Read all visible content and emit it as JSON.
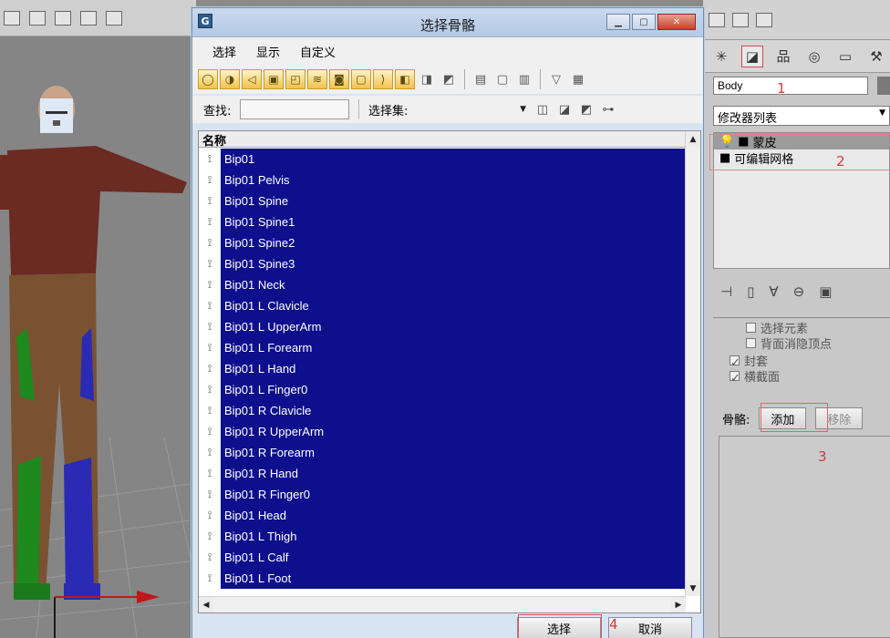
{
  "dialog": {
    "title": "选择骨骼",
    "menu": [
      "选择",
      "显示",
      "自定义"
    ],
    "find_label": "查找:",
    "find_value": "",
    "selection_set_label": "选择集:",
    "list_header": "名称",
    "bones": [
      "Bip01",
      "Bip01 Pelvis",
      "Bip01 Spine",
      "Bip01 Spine1",
      "Bip01 Spine2",
      "Bip01 Spine3",
      "Bip01 Neck",
      "Bip01 L Clavicle",
      "Bip01 L UpperArm",
      "Bip01 L Forearm",
      "Bip01 L Hand",
      "Bip01 L Finger0",
      "Bip01 R Clavicle",
      "Bip01 R UpperArm",
      "Bip01 R Forearm",
      "Bip01 R Hand",
      "Bip01 R Finger0",
      "Bip01 Head",
      "Bip01 L Thigh",
      "Bip01 L Calf",
      "Bip01 L Foot"
    ],
    "select_label": "选择",
    "cancel_label": "取消",
    "annotation": "4"
  },
  "command_panel": {
    "object_name": "Body",
    "modifier_list_label": "修改器列表",
    "stack": [
      {
        "label": "蒙皮",
        "selected": true
      },
      {
        "label": "可编辑网格",
        "selected": false
      }
    ],
    "options": [
      {
        "label": "选择元素",
        "checked": false
      },
      {
        "label": "背面消隐顶点",
        "checked": false
      },
      {
        "label": "封套",
        "checked": true
      },
      {
        "label": "横截面",
        "checked": true
      }
    ],
    "bones_label": "骨骼:",
    "add_label": "添加",
    "remove_label": "移除",
    "annotations": [
      "1",
      "2",
      "3"
    ]
  },
  "colors": {
    "selection_bg": "#0d0f8c",
    "annotation": "#d23b3b",
    "shirt": "#6b2a22",
    "pants": "#7a5232"
  }
}
